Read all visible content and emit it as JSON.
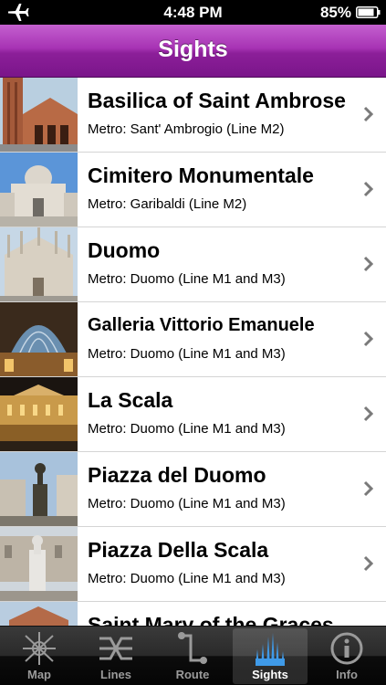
{
  "status_bar": {
    "time": "4:48 PM",
    "battery": "85%"
  },
  "nav": {
    "title": "Sights"
  },
  "sights": [
    {
      "title": "Basilica of Saint Ambrose",
      "subtitle": "Metro: Sant' Ambrogio (Line M2)"
    },
    {
      "title": "Cimitero Monumentale",
      "subtitle": "Metro: Garibaldi (Line M2)"
    },
    {
      "title": "Duomo",
      "subtitle": "Metro: Duomo (Line M1 and M3)"
    },
    {
      "title": "Galleria Vittorio Emanuele",
      "subtitle": "Metro: Duomo (Line M1 and M3)"
    },
    {
      "title": "La Scala",
      "subtitle": "Metro: Duomo (Line M1 and M3)"
    },
    {
      "title": "Piazza del Duomo",
      "subtitle": "Metro: Duomo (Line M1 and M3)"
    },
    {
      "title": "Piazza Della Scala",
      "subtitle": "Metro: Duomo (Line M1 and M3)"
    },
    {
      "title": "Saint Mary of the Graces",
      "subtitle": ""
    }
  ],
  "tabs": [
    {
      "label": "Map",
      "icon": "map-icon"
    },
    {
      "label": "Lines",
      "icon": "lines-icon"
    },
    {
      "label": "Route",
      "icon": "route-icon"
    },
    {
      "label": "Sights",
      "icon": "sights-icon",
      "active": true
    },
    {
      "label": "Info",
      "icon": "info-icon"
    }
  ],
  "colors": {
    "nav_accent": "#8c1f99",
    "chevron": "#7a7a7a"
  }
}
